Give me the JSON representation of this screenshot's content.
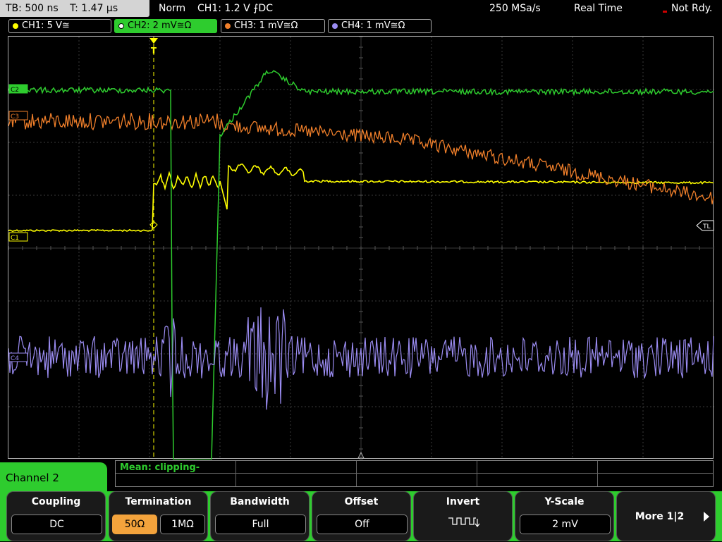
{
  "status": {
    "timebase": "TB: 500 ns",
    "trigger_time": "T: 1.47 µs",
    "mode": "Norm",
    "trigger_info": "CH1: 1.2 V ⨍DC",
    "sample_rate": "250 MSa/s",
    "acquire_mode": "Real Time",
    "ready_state": "Not Rdy."
  },
  "channels": [
    {
      "label": "CH1: 5 V≅",
      "color": "#ffff00"
    },
    {
      "label": "CH2: 2 mV≅Ω",
      "color": "#2ecc2e"
    },
    {
      "label": "CH3: 1 mV≅Ω",
      "color": "#f07f2a"
    },
    {
      "label": "CH4: 1 mV≅Ω",
      "color": "#9b8cf2"
    }
  ],
  "markers": {
    "c1": "C1",
    "c2": "C2",
    "c3": "C3",
    "c4": "C4",
    "trigger_level": "TL",
    "trigger_pos": "T"
  },
  "measurement": {
    "text": "Mean: clipping-"
  },
  "menu": {
    "title": "Channel 2",
    "coupling": {
      "title": "Coupling",
      "value": "DC"
    },
    "termination": {
      "title": "Termination",
      "options": [
        "50Ω",
        "1MΩ"
      ],
      "selected": "50Ω"
    },
    "bandwidth": {
      "title": "Bandwidth",
      "value": "Full"
    },
    "offset": {
      "title": "Offset",
      "value": "Off"
    },
    "invert": {
      "title": "Invert",
      "icon": "invert-waveform-icon"
    },
    "yscale": {
      "title": "Y-Scale",
      "value": "2 mV"
    },
    "more": {
      "label": "More 1|2"
    }
  }
}
